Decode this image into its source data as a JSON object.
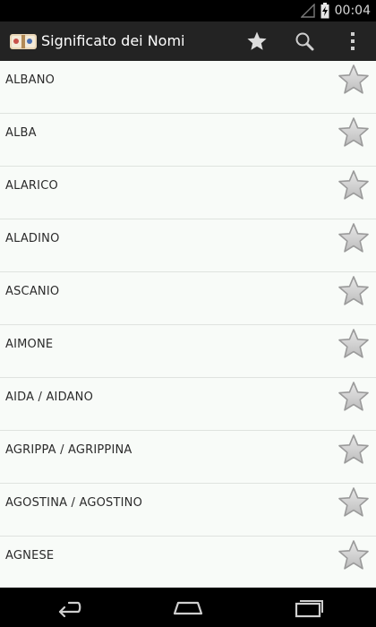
{
  "status_bar": {
    "time": "00:04",
    "battery_icon": "battery-charging-icon",
    "signal_icon": "signal-icon"
  },
  "action_bar": {
    "title": "Significato dei Nomi",
    "logo_icon": "names-book-logo-icon",
    "actions": [
      {
        "icon": "star-icon",
        "label": "Favorites"
      },
      {
        "icon": "search-icon",
        "label": "Search"
      },
      {
        "icon": "overflow-menu-icon",
        "label": "More options"
      }
    ]
  },
  "names": [
    "ALBANO",
    "ALBA",
    "ALARICO",
    "ALADINO",
    "ASCANIO",
    "AIMONE",
    "AIDA / AIDANO",
    "AGRIPPA / AGRIPPINA",
    "AGOSTINA / AGOSTINO",
    "AGNESE"
  ],
  "colors": {
    "action_bar": "#232323",
    "list_background": "#f8fbf8",
    "divider": "#dfe3df",
    "star_fill": "#d6d6d6"
  },
  "nav_bar": {
    "buttons": [
      "back-icon",
      "home-icon",
      "recent-apps-icon"
    ]
  }
}
